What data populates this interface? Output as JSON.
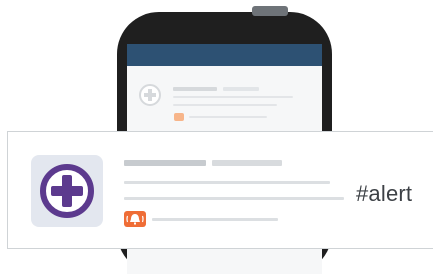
{
  "notification": {
    "tag": "#alert",
    "app_icon": "medical-plus-icon",
    "badge_icon": "alarm-bell-icon"
  },
  "colors": {
    "phone_body": "#1f1f1f",
    "app_header": "#2d5173",
    "icon_purple": "#5c3a8e",
    "badge_orange": "#ef6d36",
    "placeholder_gray": "#d0d4d8"
  }
}
